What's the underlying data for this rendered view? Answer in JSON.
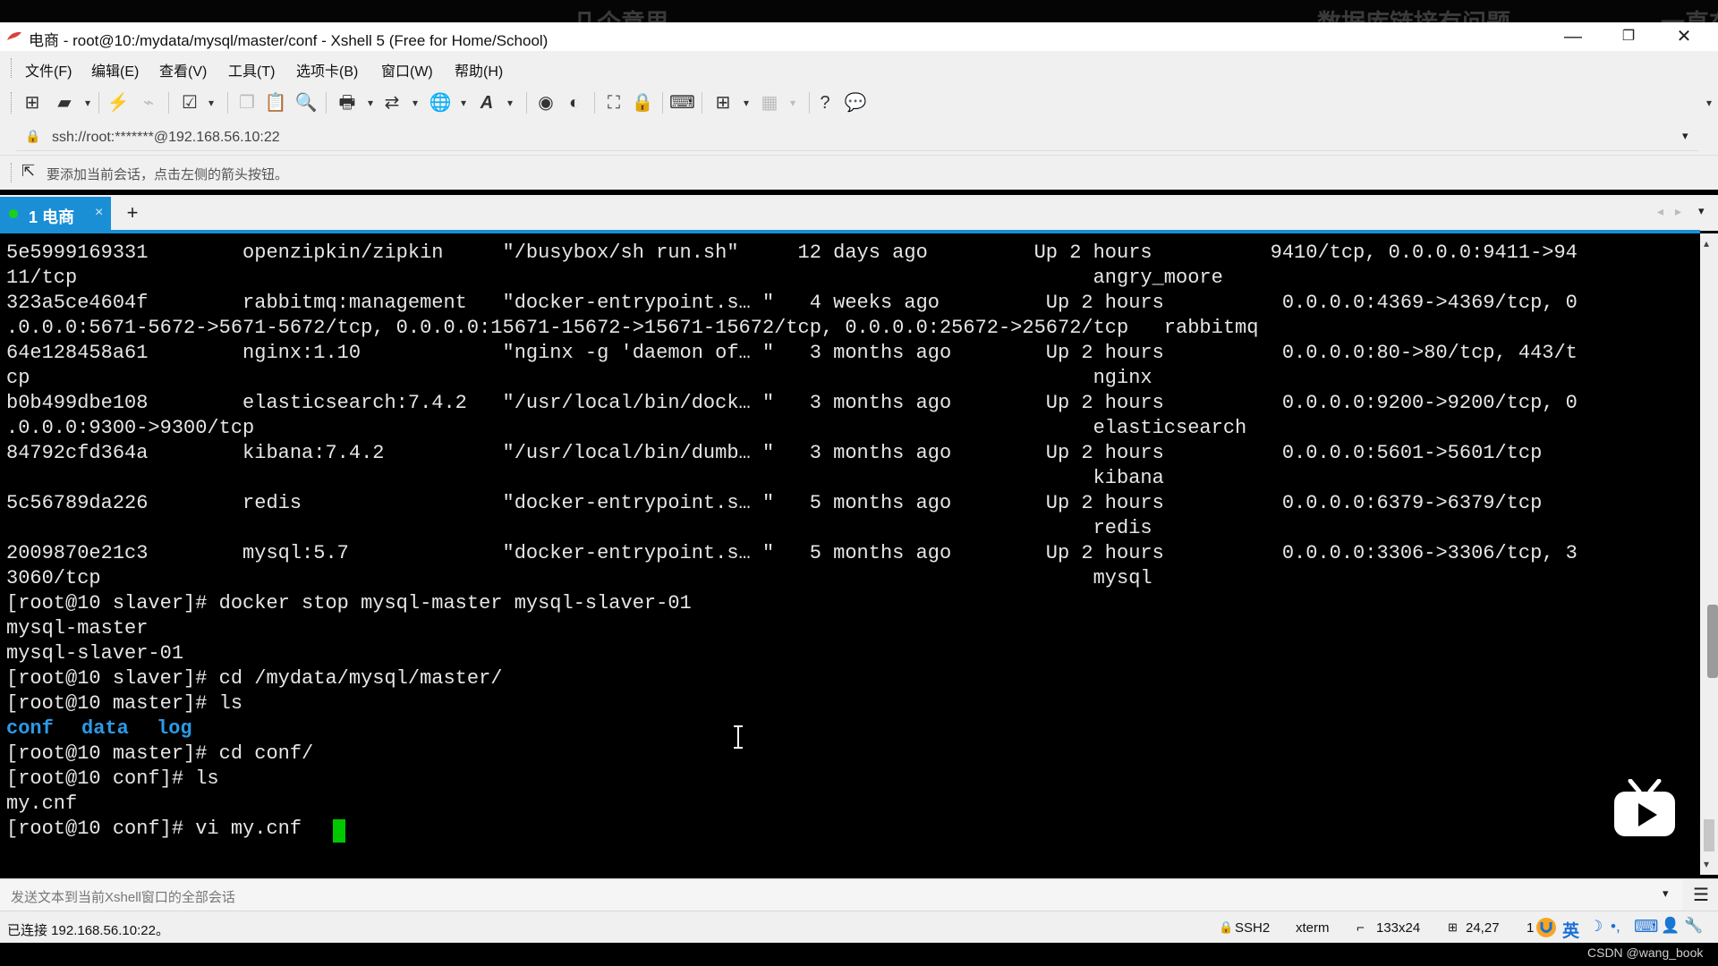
{
  "watermarks": [
    "几个意思",
    "数据库链接有问题",
    "一直在"
  ],
  "window": {
    "title": "电商 - root@10:/mydata/mysql/master/conf - Xshell 5 (Free for Home/School)",
    "controls": [
      "—",
      "❐",
      "✕"
    ]
  },
  "menu": [
    "文件(F)",
    "编辑(E)",
    "查看(V)",
    "工具(T)",
    "选项卡(B)",
    "窗口(W)",
    "帮助(H)"
  ],
  "address": "ssh://root:*******@192.168.56.10:22",
  "hint": "要添加当前会话，点击左侧的箭头按钮。",
  "tabs": [
    {
      "label": "1 电商",
      "close": "×"
    }
  ],
  "tab_add": "+",
  "terminal_lines": [
    "5e5999169331        openzipkin/zipkin     \"/busybox/sh run.sh\"     12 days ago         Up 2 hours          9410/tcp, 0.0.0.0:9411->94",
    "11/tcp                                                                                      angry_moore",
    "323a5ce4604f        rabbitmq:management   \"docker-entrypoint.s… \"   4 weeks ago         Up 2 hours          0.0.0.0:4369->4369/tcp, 0",
    ".0.0.0:5671-5672->5671-5672/tcp, 0.0.0.0:15671-15672->15671-15672/tcp, 0.0.0.0:25672->25672/tcp   rabbitmq",
    "64e128458a61        nginx:1.10            \"nginx -g 'daemon of… \"   3 months ago        Up 2 hours          0.0.0.0:80->80/tcp, 443/t",
    "cp                                                                                          nginx",
    "b0b499dbe108        elasticsearch:7.4.2   \"/usr/local/bin/dock… \"   3 months ago        Up 2 hours          0.0.0.0:9200->9200/tcp, 0",
    ".0.0.0:9300->9300/tcp                                                                       elasticsearch",
    "84792cfd364a        kibana:7.4.2          \"/usr/local/bin/dumb… \"   3 months ago        Up 2 hours          0.0.0.0:5601->5601/tcp",
    "                                                                                            kibana",
    "5c56789da226        redis                 \"docker-entrypoint.s… \"   5 months ago        Up 2 hours          0.0.0.0:6379->6379/tcp",
    "                                                                                            redis",
    "2009870e21c3        mysql:5.7             \"docker-entrypoint.s… \"   5 months ago        Up 2 hours          0.0.0.0:3306->3306/tcp, 3",
    "3060/tcp                                                                                    mysql",
    "[root@10 slaver]# docker stop mysql-master mysql-slaver-01",
    "mysql-master",
    "mysql-slaver-01",
    "[root@10 slaver]# cd /mydata/mysql/master/",
    "[root@10 master]# ls",
    "",
    "[root@10 master]# cd conf/",
    "[root@10 conf]# ls",
    "my.cnf",
    "[root@10 conf]# vi my.cnf "
  ],
  "ls_dirs": [
    "conf",
    "data",
    "log"
  ],
  "cursor_color": "#00c800",
  "send_bar": "发送文本到当前Xshell窗口的全部会话",
  "status": {
    "connected": "已连接 192.168.56.10:22。",
    "protocol": "SSH2",
    "term": "xterm",
    "size": "133x24",
    "pos": "24,27",
    "col": "1"
  },
  "ime": [
    "英"
  ],
  "credit": "CSDN @wang_book"
}
